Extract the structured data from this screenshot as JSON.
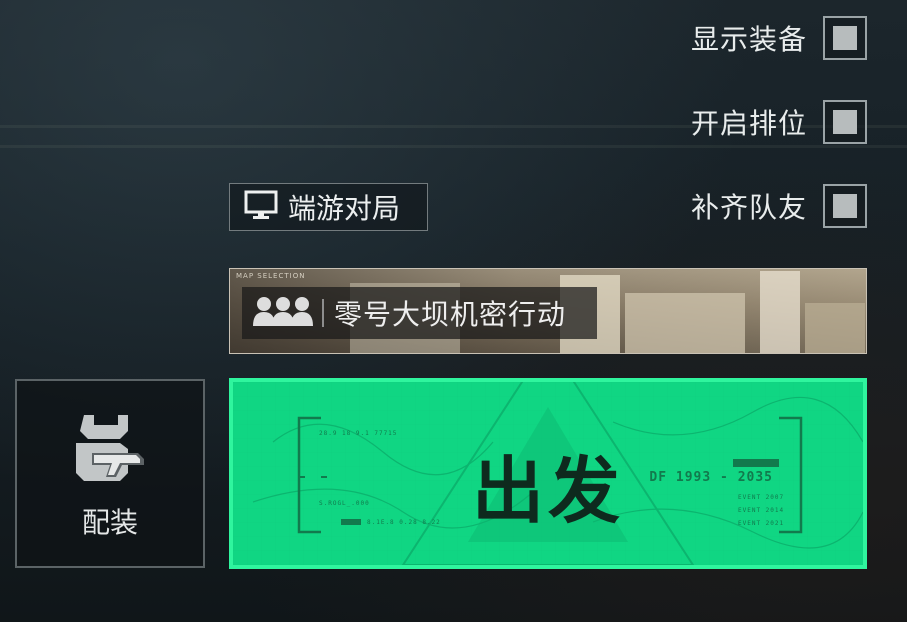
{
  "options": [
    {
      "label": "显示装备",
      "checked": true
    },
    {
      "label": "开启排位",
      "checked": true
    },
    {
      "label": "补齐队友",
      "checked": true
    }
  ],
  "pc_match": {
    "label": "端游对局",
    "icon": "monitor-icon"
  },
  "map": {
    "tag": "MAP SELECTION",
    "name": "零号大坝机密行动",
    "icon": "squad-icon"
  },
  "loadout": {
    "label": "配装",
    "icon": "loadout-gun-icon"
  },
  "deploy": {
    "label": "出发",
    "year_range": "DF 1993 - 2035",
    "events": [
      "EVENT 2007",
      "EVENT 2014",
      "EVENT 2021"
    ],
    "code_top": "28.9 18 9.1 77715",
    "code_mid": "S.ROGL_.000",
    "code_bottom": "8.1E.8 0.28 8.22"
  },
  "colors": {
    "deploy_bg": "#10d683",
    "deploy_border": "#2ff59e",
    "deploy_text": "#0e2a1e"
  }
}
